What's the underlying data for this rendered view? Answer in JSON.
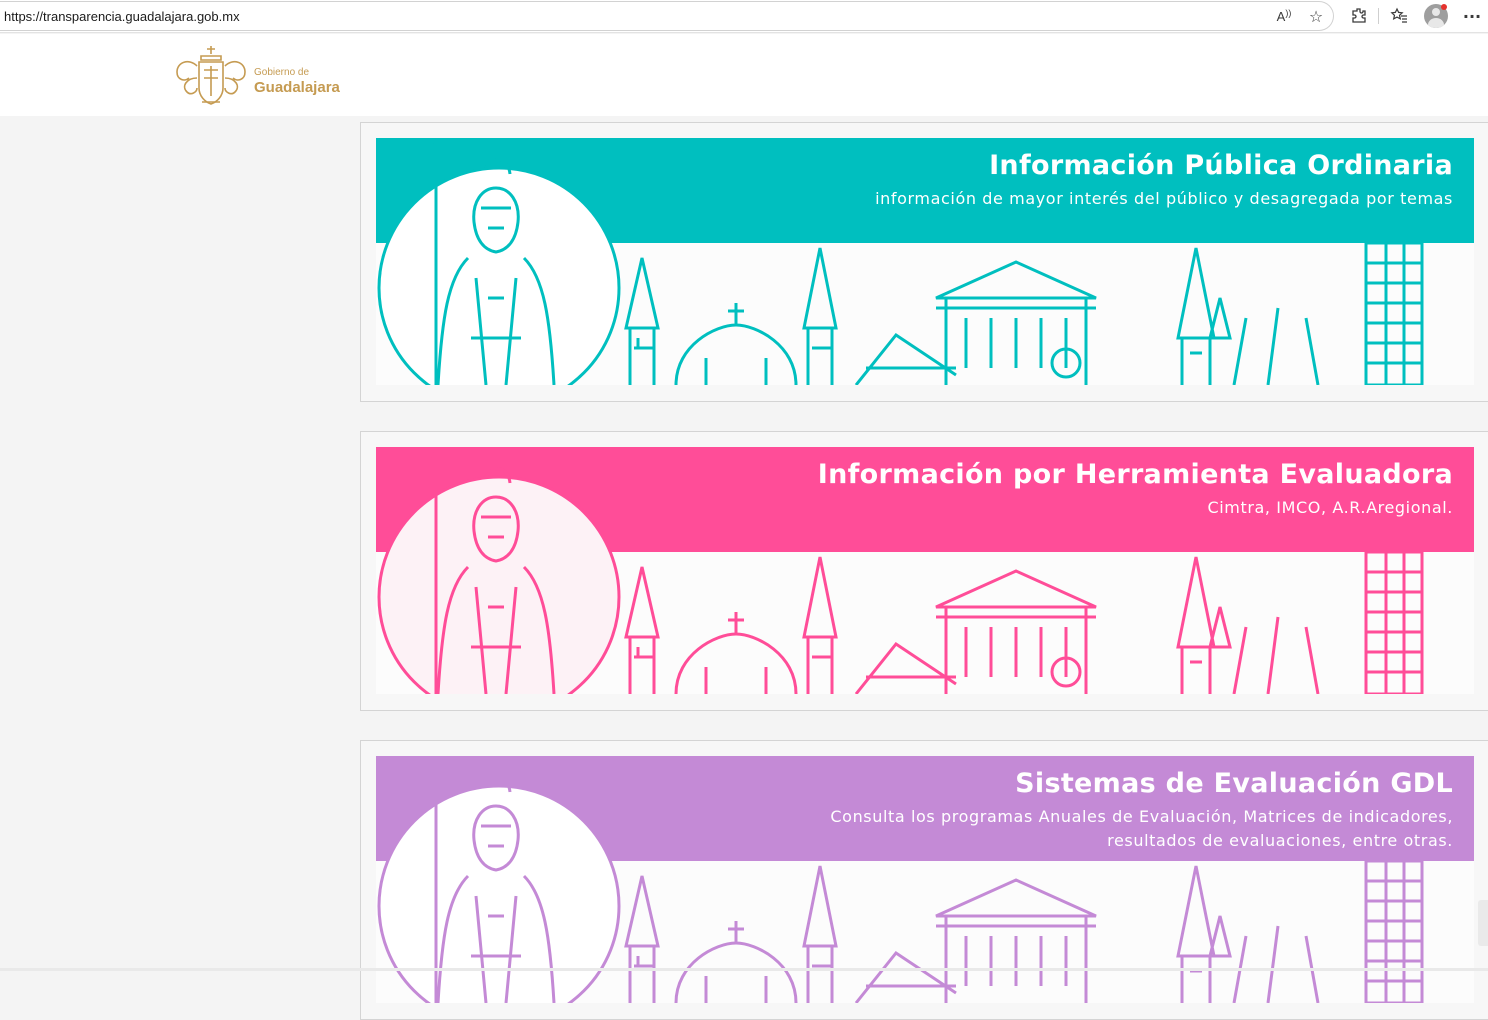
{
  "browser": {
    "url": "https://transparencia.guadalajara.gob.mx",
    "icons": [
      "read-aloud-icon",
      "favorite-star-icon",
      "extensions-icon",
      "favorites-list-icon",
      "profile-avatar",
      "more-menu-icon"
    ]
  },
  "header": {
    "logo_small": "Gobierno de",
    "logo_big": "Guadalajara",
    "logo_color": "#c59b52"
  },
  "cards": [
    {
      "title": "Información Pública Ordinaria",
      "subtitle": "información de mayor interés del público y desagregada por temas",
      "color": "#00bfbf"
    },
    {
      "title": "Información por Herramienta Evaluadora",
      "subtitle": "Cimtra, IMCO, A.R.Aregional.",
      "color": "#ff4d98"
    },
    {
      "title": "Sistemas de Evaluación GDL",
      "subtitle_line1": "Consulta los programas Anuales de Evaluación, Matrices de indicadores,",
      "subtitle_line2": "resultados de evaluaciones, entre otras.",
      "color": "#c48ad6"
    }
  ]
}
